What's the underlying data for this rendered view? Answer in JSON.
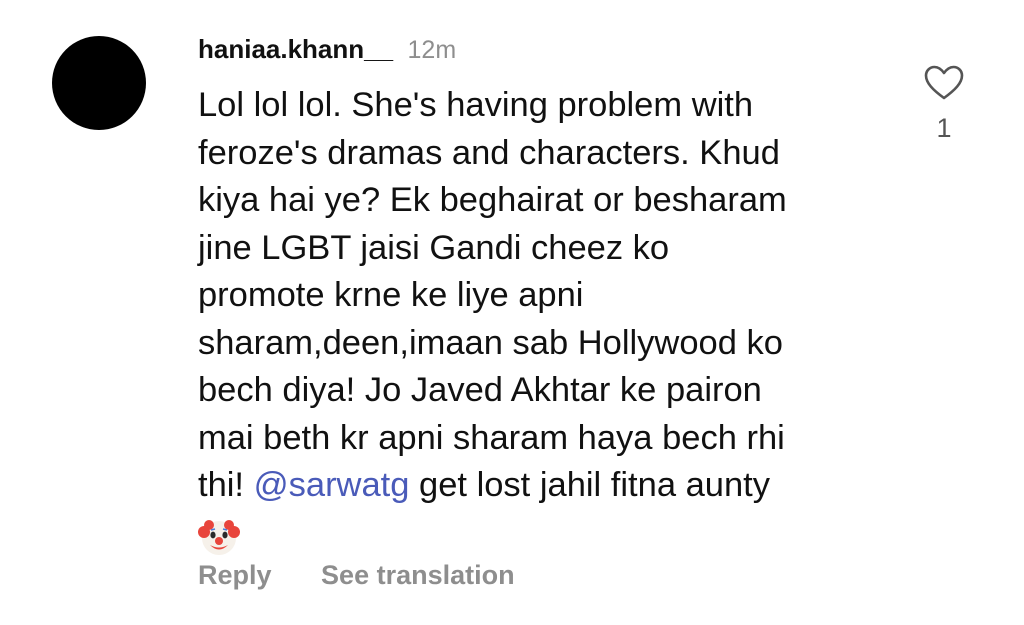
{
  "comment": {
    "username": "haniaa.khann__",
    "time": "12m",
    "lines": [
      "Lol lol lol. She's having problem with",
      "feroze's dramas and characters. Khud",
      "kiya hai ye? Ek beghairat or besharam",
      "jine LGBT jaisi Gandi cheez ko",
      "promote krne ke liye apni",
      "sharam,deen,imaan sab Hollywood ko",
      "bech diya! Jo Javed Akhtar ke pairon",
      "mai beth kr apni sharam haya bech rhi"
    ],
    "last_line_before": "thi! ",
    "mention": "@sarwatg",
    "last_line_after": " get lost jahil fitna aunty",
    "emoji": "clown-face-icon"
  },
  "actions": {
    "reply": "Reply",
    "see_translation": "See translation"
  },
  "like": {
    "icon": "heart-outline-icon",
    "count": "1"
  },
  "colors": {
    "text": "#111111",
    "muted": "#8e8e8e",
    "mention": "#4a5bb9",
    "avatar": "#000000"
  }
}
